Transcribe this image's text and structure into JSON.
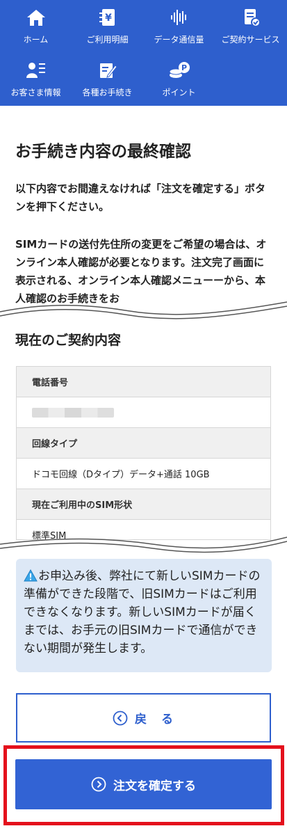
{
  "nav": {
    "items": [
      {
        "label": "ホーム",
        "icon": "home-icon"
      },
      {
        "label": "ご利用明細",
        "icon": "billing-statement-icon"
      },
      {
        "label": "データ通信量",
        "icon": "data-usage-icon"
      },
      {
        "label": "ご契約サービス",
        "icon": "contract-service-icon"
      },
      {
        "label": "お客さま情報",
        "icon": "customer-info-icon"
      },
      {
        "label": "各種お手続き",
        "icon": "procedures-icon"
      },
      {
        "label": "ポイント",
        "icon": "points-icon"
      }
    ],
    "color": "#2e5fcd"
  },
  "page": {
    "title": "お手続き内容の最終確認",
    "intro": "以下内容でお間違えなければ「注文を確定する」ボタンを押下ください。",
    "sim_notice": "SIMカードの送付先住所の変更をご希望の場合は、オンライン本人確認が必要となります。注文完了画面に表示される、オンライン本人確認メニューーから、本人確認のお手続きをお"
  },
  "contract": {
    "heading": "現在のご契約内容",
    "rows": [
      {
        "label": "電話番号",
        "value": ""
      },
      {
        "label": "回線タイプ",
        "value": "ドコモ回線（Dタイプ）データ+通話 10GB"
      },
      {
        "label": "現在ご利用中のSIM形状",
        "value": "標準SIM"
      }
    ]
  },
  "notice": {
    "text": "お申込み後、弊社にて新しいSIMカードの準備ができた段階で、旧SIMカードはご利用できなくなります。新しいSIMカードが届くまでは、お手元の旧SIMカードで通信ができない期間が発生します。",
    "icon": "warning-icon"
  },
  "buttons": {
    "back": "戻　る",
    "confirm": "注文を確定する"
  },
  "colors": {
    "accent": "#2e5fcd",
    "highlight": "#e4101c",
    "notice_bg": "#dde8f6"
  }
}
